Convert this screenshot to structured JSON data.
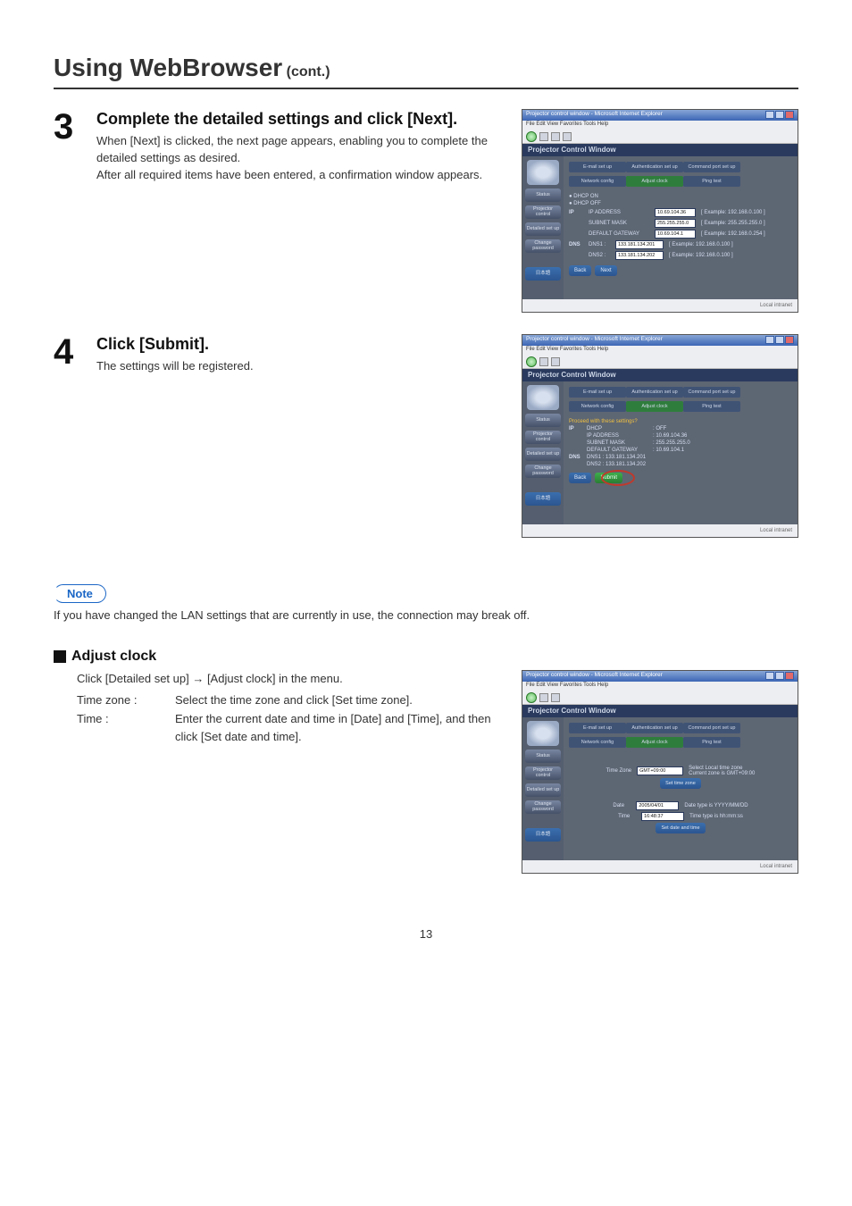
{
  "page_title_main": "Using WebBrowser",
  "page_title_cont": " (cont.)",
  "page_number": "13",
  "ie_window_title": "Projector control window - Microsoft Internet Explorer",
  "ie_menu": "File   Edit   View   Favorites   Tools   Help",
  "ie_status": "Local intranet",
  "pcw_title": "Projector Control Window",
  "sidebar": {
    "status": "Status",
    "projector": "Projector control",
    "detailed": "Detailed set up",
    "change": "Change password",
    "jp": "日本語"
  },
  "tabs": {
    "email": "E-mail set up",
    "auth": "Authentication set up",
    "cmd": "Command port set up",
    "net": "Network config",
    "adj": "Adjust clock",
    "ping": "Ping test"
  },
  "buttons": {
    "back": "Back",
    "next": "Next",
    "submit": "Submit",
    "set_tz": "Set time zone",
    "set_dt": "Set date and time"
  },
  "step3": {
    "num": "3",
    "title": "Complete the detailed settings and click [Next].",
    "line1": "When [Next] is clicked, the next page appears, enabling you to complete the detailed settings as desired.",
    "line2": "After all required items have been entered, a confirmation window appears.",
    "fields": {
      "dhcp_on": "● DHCP ON",
      "dhcp_off": "● DHCP OFF",
      "ip_row_label": "IP",
      "ip": "IP ADDRESS",
      "ip_v": "10.69.104.36",
      "ip_ex": "[ Example: 192.168.0.100 ]",
      "sm": "SUBNET MASK",
      "sm_v": "255.255.255.0",
      "sm_ex": "[ Example: 255.255.255.0 ]",
      "gw": "DEFAULT GATEWAY",
      "gw_v": "10.69.104.1",
      "gw_ex": "[ Example: 192.168.0.254 ]",
      "dns_row_label": "DNS",
      "dns1": "DNS1 :",
      "dns1_v": "133.181.134.201",
      "dns1_ex": "[ Example: 192.168.0.100 ]",
      "dns2": "DNS2 :",
      "dns2_v": "133.181.134.202",
      "dns2_ex": "[ Example: 192.168.0.100 ]"
    }
  },
  "step4": {
    "num": "4",
    "title": "Click [Submit].",
    "line1": "The settings will be registered.",
    "confirm_msg": "Proceed with these settings?",
    "fields": {
      "dhcp": "DHCP",
      "dhcp_v": ": OFF",
      "ip": "IP ADDRESS",
      "ip_v": ": 10.69.104.36",
      "sm": "SUBNET MASK",
      "sm_v": ": 255.255.255.0",
      "gw": "DEFAULT GATEWAY",
      "gw_v": ": 10.69.104.1",
      "ip_row_label": "IP",
      "dns_row_label": "DNS",
      "dns1": "DNS1 : 133.181.134.201",
      "dns2": "DNS2 : 133.181.134.202"
    }
  },
  "note": {
    "label": "Note",
    "text": "If you have changed the LAN settings that are currently in use, the connection may break off."
  },
  "adjust": {
    "heading": "Adjust clock",
    "intro": "Click [Detailed set up] → [Adjust clock] in the menu.",
    "tz_label": "Time zone :",
    "tz_text": "Select the time zone and click [Set time zone].",
    "time_label": "Time :",
    "time_text": "Enter the current date and time in [Date] and [Time], and then click [Set date and time].",
    "fig": {
      "tz_label": "Time Zone",
      "tz_v": "GMT+09:00",
      "tz_info1": "Select Local time zone",
      "tz_info2": "Current zone is GMT+09:00",
      "date_label": "Date",
      "date_v": "2005/04/01",
      "date_info": "Date type is YYYY/MM/DD",
      "time_label": "Time",
      "time_v": "16:48:37",
      "time_info": "Time type is hh:mm:ss"
    }
  }
}
